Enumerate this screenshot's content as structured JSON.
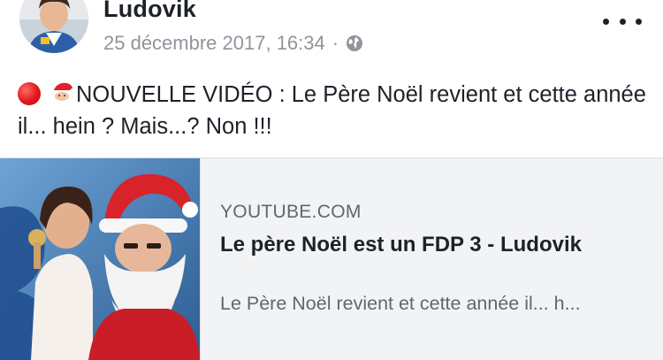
{
  "post": {
    "author_name": "Ludovik",
    "timestamp": "25 décembre 2017, 16:34",
    "separator": "·",
    "privacy_icon": "globe-icon",
    "more_icon": "more-options-icon",
    "text": "NOUVELLE VIDÉO : Le Père Noël revient et cette année il... hein ? Mais...? Non !!!",
    "emojis": [
      "red-circle-icon",
      "santa-emoji-icon"
    ]
  },
  "link_preview": {
    "domain": "YOUTUBE.COM",
    "title": "Le père Noël est un FDP 3 - Ludovik",
    "description": "Le Père Noël revient et cette année il... h..."
  },
  "colors": {
    "text_primary": "#1d2129",
    "text_secondary": "#90949c",
    "card_background": "#f2f3f5",
    "card_muted_text": "#606770"
  }
}
